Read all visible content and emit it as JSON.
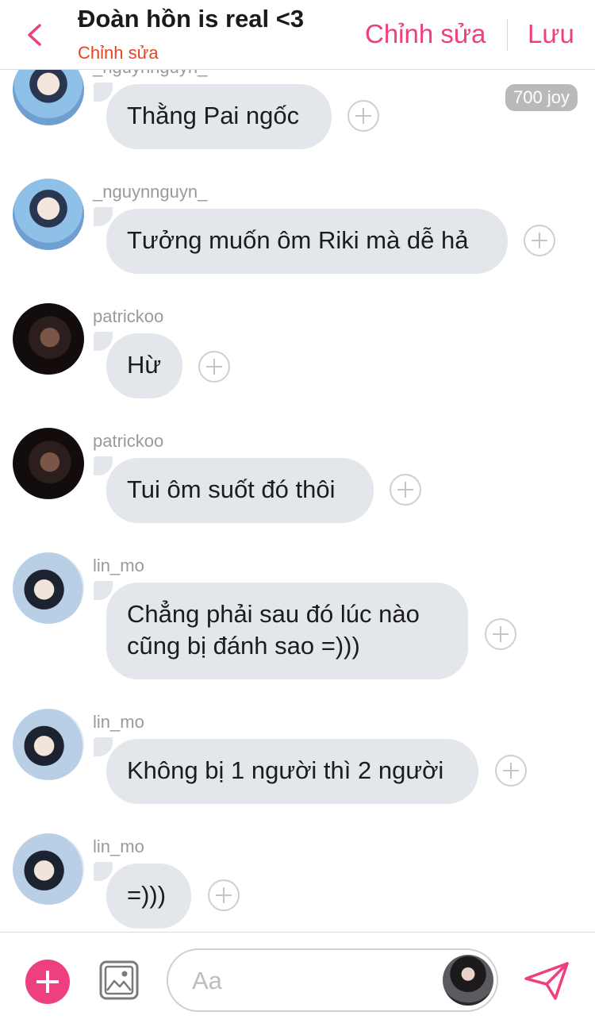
{
  "header": {
    "title": "Đoàn hồn is real <3",
    "subtitle": "Chỉnh sửa",
    "edit_label": "Chỉnh sửa",
    "save_label": "Lưu",
    "back_icon": "chevron-left-icon",
    "accent_color": "#ee3f80",
    "subtitle_color": "#e8431f"
  },
  "messages": [
    {
      "username": "_nguynnguyn_",
      "text": "Thằng Pai ngốc",
      "avatar": "avatar-nguynnguyn"
    },
    {
      "username": "_nguynnguyn_",
      "text": "Tưởng muốn ôm Riki mà dễ hả",
      "avatar": "avatar-nguynnguyn"
    },
    {
      "username": "patrickoo",
      "text": "Hừ",
      "avatar": "avatar-patrickoo"
    },
    {
      "username": "patrickoo",
      "text": "Tui ôm suốt đó thôi",
      "avatar": "avatar-patrickoo"
    },
    {
      "username": "lin_mo",
      "text_lines": [
        "Chẳng phải sau đó lúc nào",
        "cũng bị đánh sao =)))"
      ],
      "avatar": "avatar-lin-mo"
    },
    {
      "username": "lin_mo",
      "text": "Không bị 1 người thì 2 người",
      "avatar": "avatar-lin-mo"
    },
    {
      "username": "lin_mo",
      "text": "=)))",
      "avatar": "avatar-lin-mo"
    }
  ],
  "joy_badge": "700 joy",
  "composer": {
    "placeholder": "Aa",
    "value": "",
    "plus_icon": "plus-icon",
    "gallery_icon": "image-icon",
    "send_icon": "send-icon"
  },
  "colors": {
    "bubble": "#e3e6ea",
    "username": "#9a9a9a",
    "react_button": "#cfcfcf"
  }
}
